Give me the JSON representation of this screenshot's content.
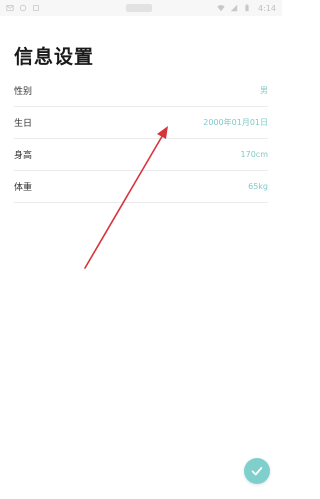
{
  "status_bar": {
    "time": "4:14",
    "left_icons": [
      "mail-icon",
      "sync-icon",
      "notification-icon"
    ],
    "right_icons": [
      "wifi-icon",
      "signal-icon",
      "battery-icon"
    ]
  },
  "page": {
    "title": "信息设置"
  },
  "settings": {
    "items": [
      {
        "label": "性别",
        "value": "男"
      },
      {
        "label": "生日",
        "value": "2000年01月01日"
      },
      {
        "label": "身高",
        "value": "170cm"
      },
      {
        "label": "体重",
        "value": "65kg"
      }
    ]
  },
  "colors": {
    "accent": "#7fc9c9",
    "fab": "#7fd0cc",
    "arrow": "#d8343c",
    "divider": "#ececec",
    "title": "#1a1a1a"
  },
  "fab": {
    "icon": "check-icon"
  }
}
